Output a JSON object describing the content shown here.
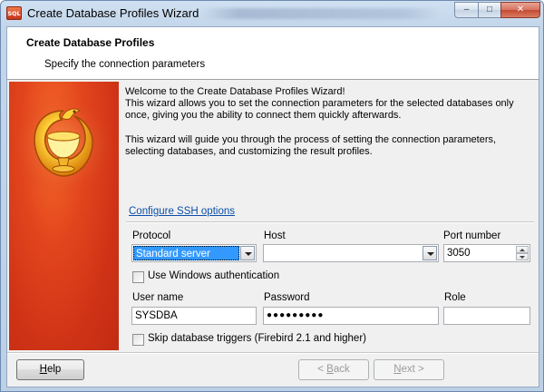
{
  "window": {
    "title": "Create Database Profiles Wizard",
    "app_icon_text": "SQL",
    "buttons": {
      "minimize": "–",
      "maximize": "□",
      "close": "✕"
    }
  },
  "header": {
    "title": "Create Database Profiles",
    "subtitle": "Specify the connection parameters"
  },
  "welcome": {
    "line1": "Welcome to the Create Database Profiles Wizard!",
    "line2": "This wizard allows you to set the connection parameters for the selected databases only once, giving you the ability to connect them quickly afterwards.",
    "line3": "This wizard will guide you through the process of setting the connection parameters, selecting databases, and customizing the result profiles."
  },
  "ssh_link": "Configure SSH options",
  "form": {
    "protocol_label": "Protocol",
    "protocol_value": "Standard server",
    "host_label": "Host",
    "host_value": "",
    "port_label": "Port number",
    "port_value": "3050",
    "windows_auth_label": "Use Windows authentication",
    "windows_auth_checked": false,
    "username_label": "User name",
    "username_value": "SYSDBA",
    "password_label": "Password",
    "password_value": "●●●●●●●●●",
    "role_label": "Role",
    "role_value": "",
    "skip_triggers_label": "Skip database triggers (Firebird 2.1 and higher)",
    "skip_triggers_checked": false
  },
  "footer": {
    "help": {
      "pre": "",
      "key": "H",
      "post": "elp"
    },
    "back": {
      "pre": "< ",
      "key": "B",
      "post": "ack"
    },
    "next": {
      "pre": "",
      "key": "N",
      "post": "ext >"
    }
  },
  "colors": {
    "banner_red": "#d33a18",
    "link_blue": "#0a4fa8",
    "selection_blue": "#3399ff"
  },
  "icons": {
    "banner": "phoenix-logo-icon"
  }
}
